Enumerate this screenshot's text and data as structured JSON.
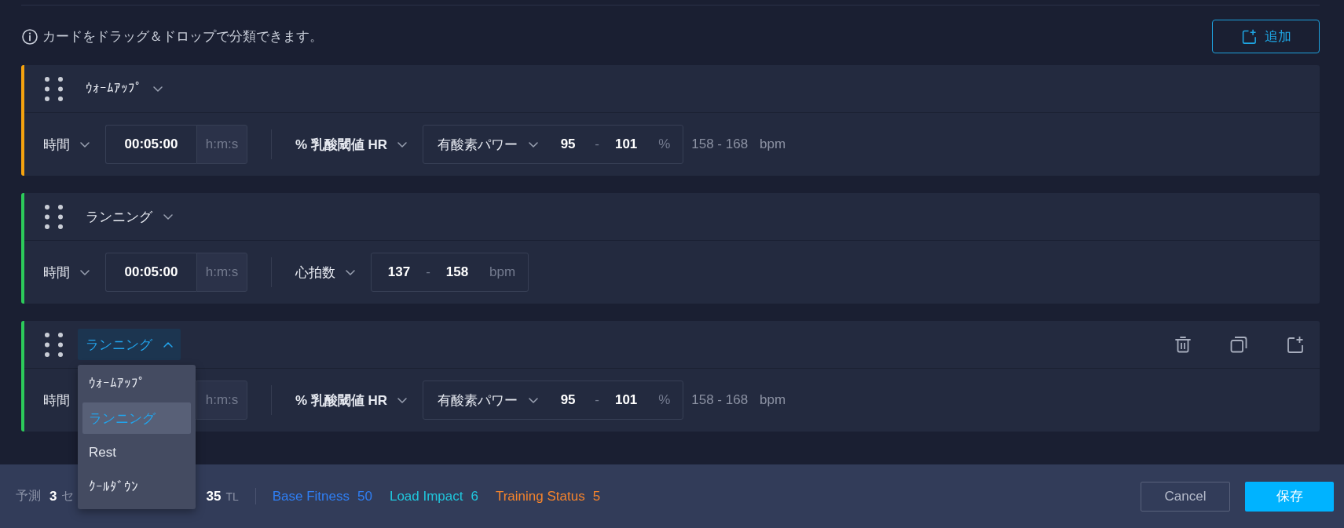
{
  "hint": "カードをドラッグ＆ドロップで分類できます。",
  "add_button": {
    "label": "追加"
  },
  "steps": [
    {
      "color": "#f5a30f",
      "active": false,
      "type_select": {
        "label": "ｳｫｰﾑｱｯﾌﾟ",
        "expanded": false
      },
      "duration": {
        "metric": "時間",
        "value": "00:05:00",
        "unit": "h:m:s"
      },
      "target": {
        "kind": "zone",
        "metric": "% 乳酸閾値 HR",
        "zone": "有酸素パワー",
        "low": "95",
        "separator": "-",
        "high": "101",
        "unit": "%",
        "range": "158 - 168",
        "range_unit": "bpm"
      }
    },
    {
      "color": "#2ccb5a",
      "active": false,
      "type_select": {
        "label": "ランニング",
        "expanded": false
      },
      "duration": {
        "metric": "時間",
        "value": "00:05:00",
        "unit": "h:m:s"
      },
      "target": {
        "kind": "range",
        "metric": "心拍数",
        "low": "137",
        "separator": "-",
        "high": "158",
        "unit": "bpm"
      }
    },
    {
      "color": "#2ccb5a",
      "active": true,
      "type_select": {
        "label": "ランニング",
        "expanded": true,
        "options": [
          {
            "label": "ｳｫｰﾑｱｯﾌﾟ",
            "selected": false
          },
          {
            "label": "ランニング",
            "selected": true
          },
          {
            "label": "Rest",
            "selected": false
          },
          {
            "label": "ｸｰﾙﾀﾞｳﾝ",
            "selected": false
          }
        ]
      },
      "duration": {
        "metric": "時間",
        "unit": "h:m:s"
      },
      "target": {
        "kind": "zone",
        "metric": "% 乳酸閾値 HR",
        "zone": "有酸素パワー",
        "low": "95",
        "separator": "-",
        "high": "101",
        "unit": "%",
        "range": "158 - 168",
        "range_unit": "bpm"
      }
    }
  ],
  "footer": {
    "forecast": {
      "label": "予測",
      "count": "3",
      "unit": "セ"
    },
    "load": {
      "value": "35",
      "unit": "TL"
    },
    "metrics": [
      {
        "label": "Base Fitness",
        "value": "50",
        "color": "#2f7ff5"
      },
      {
        "label": "Load Impact",
        "value": "6",
        "color": "#20c6dc"
      },
      {
        "label": "Training Status",
        "value": "5",
        "color": "#f6842c"
      }
    ],
    "buttons": [
      {
        "label": "Cancel",
        "kind": "secondary"
      },
      {
        "label": "保存",
        "kind": "primary"
      }
    ]
  }
}
